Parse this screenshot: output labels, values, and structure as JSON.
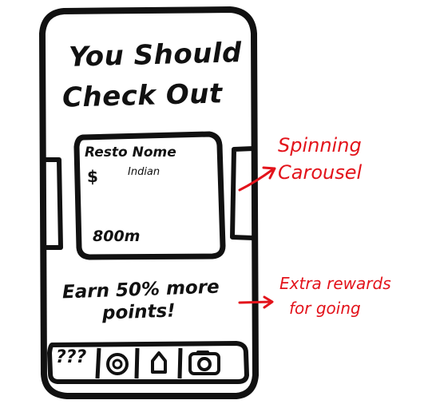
{
  "screen": {
    "title_line1": "You Should",
    "title_line2": "Check Out"
  },
  "carousel_card": {
    "name": "Resto Nome",
    "price": "$",
    "cuisine": "Indian",
    "distance": "800m"
  },
  "promo": {
    "line1": "Earn 50% more",
    "line2": "points!"
  },
  "bottom_nav": {
    "first_item": "???"
  },
  "annotations": {
    "carousel_note_line1": "Spinning",
    "carousel_note_line2": "Carousel",
    "rewards_note_line1": "Extra rewards",
    "rewards_note_line2": "for going"
  },
  "colors": {
    "ink": "#111111",
    "annotation": "#e3131b",
    "background": "#ffffff"
  }
}
